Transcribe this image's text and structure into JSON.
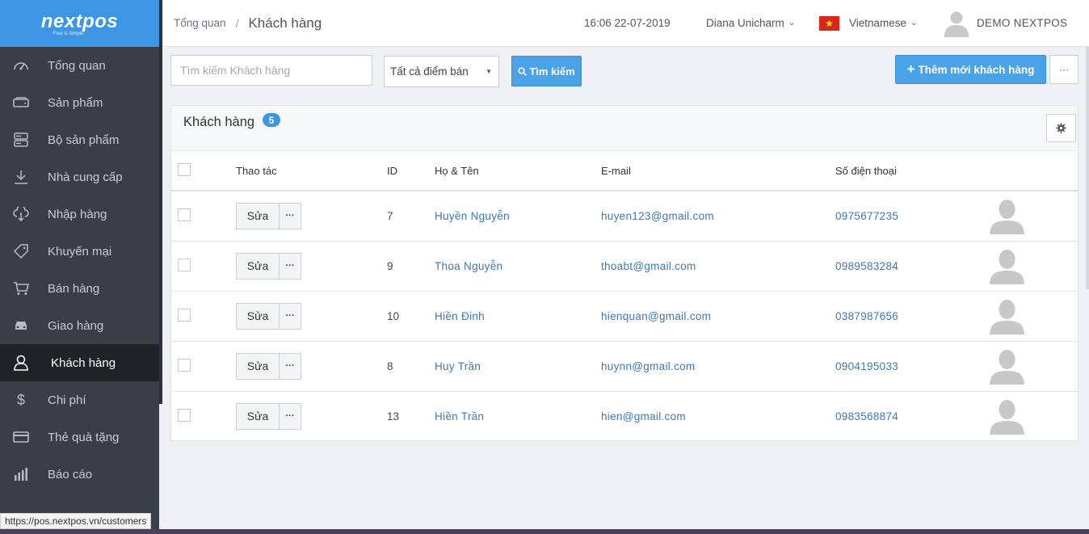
{
  "brand": {
    "name": "nextpos",
    "tagline": "Free & Simple"
  },
  "sidebar": {
    "items": [
      {
        "label": "Tổng quan",
        "icon": "dashboard-icon"
      },
      {
        "label": "Sản phẩm",
        "icon": "product-icon"
      },
      {
        "label": "Bộ sản phẩm",
        "icon": "server-icon"
      },
      {
        "label": "Nhà cung cấp",
        "icon": "download-icon"
      },
      {
        "label": "Nhập hàng",
        "icon": "cloud-download-icon"
      },
      {
        "label": "Khuyến mại",
        "icon": "tag-icon"
      },
      {
        "label": "Bán hàng",
        "icon": "cart-icon"
      },
      {
        "label": "Giao hàng",
        "icon": "car-icon"
      },
      {
        "label": "Khách hàng",
        "icon": "user-icon",
        "active": true
      },
      {
        "label": "Chi phí",
        "icon": "dollar-icon"
      },
      {
        "label": "Thẻ quà tặng",
        "icon": "card-icon"
      },
      {
        "label": "Báo cáo",
        "icon": "bar-chart-icon"
      }
    ]
  },
  "header": {
    "breadcrumb_home": "Tổng quan",
    "breadcrumb_sep": "/",
    "breadcrumb_current": "Khách hàng",
    "datetime": "16:06 22-07-2019",
    "user": "Diana Unicharm",
    "language": "Vietnamese",
    "account": "DEMO NEXTPOS"
  },
  "toolbar": {
    "search_placeholder": "Tìm kiếm Khách hàng",
    "store_filter": "Tất cả điểm bán",
    "search_label": "Tìm kiếm",
    "add_label": "Thêm mới khách hàng",
    "more_label": "···"
  },
  "panel": {
    "title": "Khách hàng",
    "count": "5"
  },
  "table": {
    "columns": {
      "actions": "Thao tác",
      "id": "ID",
      "name": "Họ & Tên",
      "email": "E-mail",
      "phone": "Số điện thoại"
    },
    "edit_label": "Sửa",
    "rows": [
      {
        "id": "7",
        "name": "Huyền Nguyễn",
        "email": "huyen123@gmail.com",
        "phone": "0975677235"
      },
      {
        "id": "9",
        "name": "Thoa Nguyễn",
        "email": "thoabt@gmail.com",
        "phone": "0989583284"
      },
      {
        "id": "10",
        "name": "Hiền Đinh",
        "email": "hienquan@gmail.com",
        "phone": "0387987656"
      },
      {
        "id": "8",
        "name": "Huy Trần",
        "email": "huynn@gmail.com",
        "phone": "0904195033"
      },
      {
        "id": "13",
        "name": "Hiền Trần",
        "email": "hien@gmail.com",
        "phone": "0983568874"
      }
    ]
  },
  "status_url": "https://pos.nextpos.vn/customers",
  "colors": {
    "primary": "#4aa3e8",
    "sidebar": "#3a3e46",
    "active": "#1f2227",
    "link": "#3b7ab8"
  }
}
